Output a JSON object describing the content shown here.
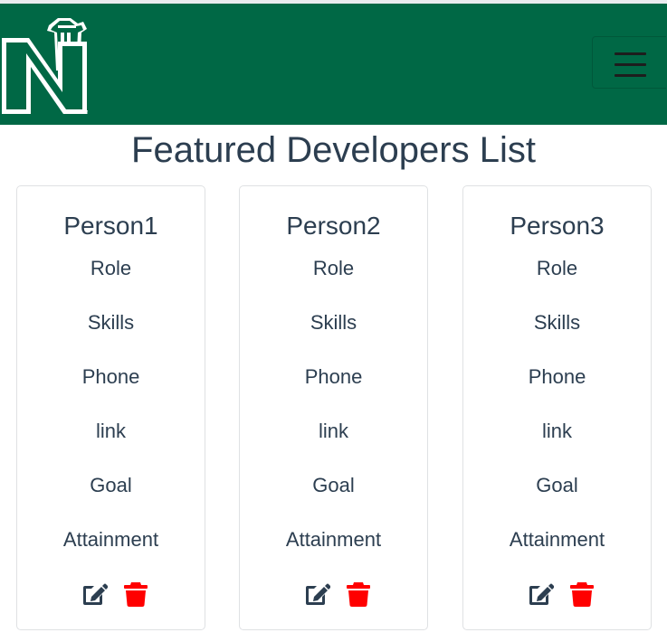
{
  "header": {
    "logo_letter": "N",
    "brand_color": "#006845",
    "menu_icon": "hamburger-icon"
  },
  "page": {
    "title": "Featured Developers List"
  },
  "cards": [
    {
      "name": "Person1",
      "role": "Role",
      "skills": "Skills",
      "phone": "Phone",
      "link": "link",
      "goal": "Goal",
      "attainment": "Attainment"
    },
    {
      "name": "Person2",
      "role": "Role",
      "skills": "Skills",
      "phone": "Phone",
      "link": "link",
      "goal": "Goal",
      "attainment": "Attainment"
    },
    {
      "name": "Person3",
      "role": "Role",
      "skills": "Skills",
      "phone": "Phone",
      "link": "link",
      "goal": "Goal",
      "attainment": "Attainment"
    }
  ],
  "icons": {
    "edit": "edit-icon",
    "delete": "trash-icon",
    "edit_color": "#2c3e50",
    "delete_color": "#ff0000"
  }
}
